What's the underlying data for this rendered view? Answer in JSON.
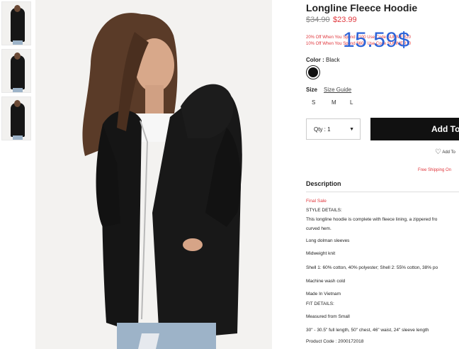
{
  "product": {
    "title": "Longline Fleece Hoodie",
    "old_price": "$34.90",
    "new_price": "$23.99",
    "overlay_price": "15.59$"
  },
  "promos": [
    "20% Off When You Spend $100 Use Code SUMMER20",
    "10% Off When You Spend $60+ Use Code SUMMER10"
  ],
  "color": {
    "label": "Color :",
    "value": "Black",
    "swatch_color": "#111111"
  },
  "size": {
    "label": "Size",
    "guide_link": "Size Guide",
    "options": [
      "S",
      "M",
      "L"
    ]
  },
  "quantity": {
    "label": "Qty : 1",
    "caret": "▼"
  },
  "add_button": "Add To",
  "wishlist": "Add To",
  "free_shipping": "Free Shipping On",
  "description": {
    "title": "Description",
    "final_sale": "Final Sale",
    "style_details_heading": "STYLE DETAILS:",
    "text_line1": "This longline hoodie is complete with fleece lining, a zippered fro",
    "text_line2": "curved hem.",
    "bullets": [
      "Long dolman sleeves",
      "Midweight knit",
      "Shell 1: 60% cotton, 40% polyester; Shell 2: 55% cotton, 38% po",
      "Machine wash cold",
      "Made In Vietnam"
    ],
    "fit_details_heading": "FIT DETAILS:",
    "fit_lines": [
      "Measured from Small",
      "30\" - 30.5\" full length, 50\" chest, 46\" waist, 24\" sleeve length"
    ],
    "product_code": "Product Code : 2000172018"
  }
}
